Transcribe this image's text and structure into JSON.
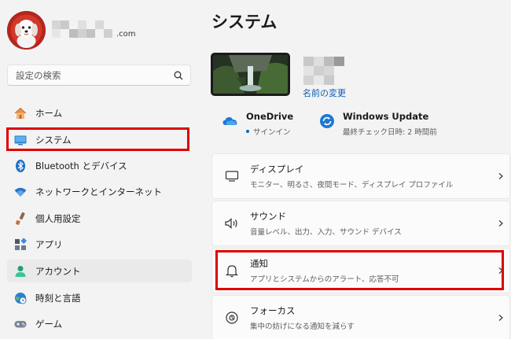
{
  "account": {
    "email_suffix": ".com"
  },
  "search": {
    "placeholder": "設定の検索"
  },
  "sidebar": {
    "items": [
      {
        "label": "ホーム",
        "icon": "home-icon"
      },
      {
        "label": "システム",
        "icon": "display-icon"
      },
      {
        "label": "Bluetooth とデバイス",
        "icon": "bluetooth-icon"
      },
      {
        "label": "ネットワークとインターネット",
        "icon": "wifi-icon"
      },
      {
        "label": "個人用設定",
        "icon": "brush-icon"
      },
      {
        "label": "アプリ",
        "icon": "apps-icon"
      },
      {
        "label": "アカウント",
        "icon": "person-icon"
      },
      {
        "label": "時刻と言語",
        "icon": "globe-clock-icon"
      },
      {
        "label": "ゲーム",
        "icon": "gamepad-icon"
      }
    ]
  },
  "main": {
    "title": "システム",
    "device": {
      "rename_label": "名前の変更"
    },
    "quick": {
      "onedrive": {
        "title": "OneDrive",
        "sub": "サインイン"
      },
      "update": {
        "title": "Windows Update",
        "sub": "最終チェック日時: 2 時間前"
      }
    },
    "cards": [
      {
        "title": "ディスプレイ",
        "sub": "モニター、明るさ、夜間モード、ディスプレイ プロファイル",
        "icon": "monitor-icon"
      },
      {
        "title": "サウンド",
        "sub": "音量レベル、出力、入力、サウンド デバイス",
        "icon": "speaker-icon"
      },
      {
        "title": "通知",
        "sub": "アプリとシステムからのアラート、応答不可",
        "icon": "bell-icon"
      },
      {
        "title": "フォーカス",
        "sub": "集中の妨げになる通知を減らす",
        "icon": "focus-icon"
      }
    ]
  },
  "colors": {
    "accent": "#0067c0",
    "highlight": "#e00000",
    "background": "#f3f3f3"
  }
}
